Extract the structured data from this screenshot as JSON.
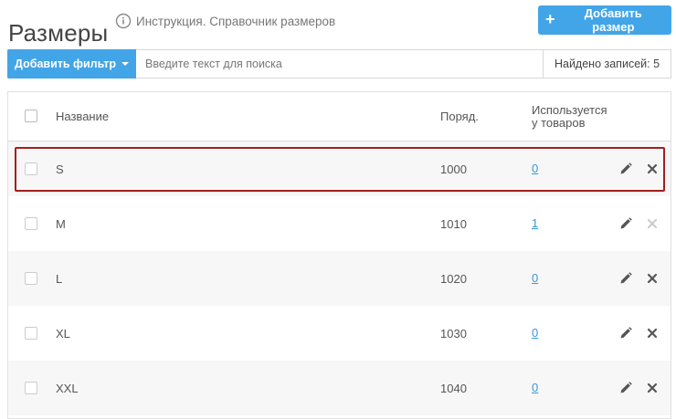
{
  "header": {
    "title": "Размеры",
    "help_link": "Инструкция. Справочник размеров",
    "add_button": "Добавить размер"
  },
  "filter": {
    "filter_button": "Добавить фильтр",
    "search_placeholder": "Введите текст для поиска",
    "records_found": "Найдено записей: 5"
  },
  "table": {
    "columns": {
      "name": "Название",
      "order": "Поряд.",
      "used_line1": "Используется",
      "used_line2": "у товаров"
    },
    "rows": [
      {
        "name": "S",
        "order": "1000",
        "used": "0",
        "deletable": true
      },
      {
        "name": "M",
        "order": "1010",
        "used": "1",
        "deletable": false
      },
      {
        "name": "L",
        "order": "1020",
        "used": "0",
        "deletable": true
      },
      {
        "name": "XL",
        "order": "1030",
        "used": "0",
        "deletable": true
      },
      {
        "name": "XXL",
        "order": "1040",
        "used": "0",
        "deletable": true
      }
    ]
  },
  "colors": {
    "accent": "#42a5e8",
    "link": "#3a97d4",
    "highlight": "#a31f1f",
    "icon": "#555555",
    "icon_disabled": "#cccccc"
  }
}
